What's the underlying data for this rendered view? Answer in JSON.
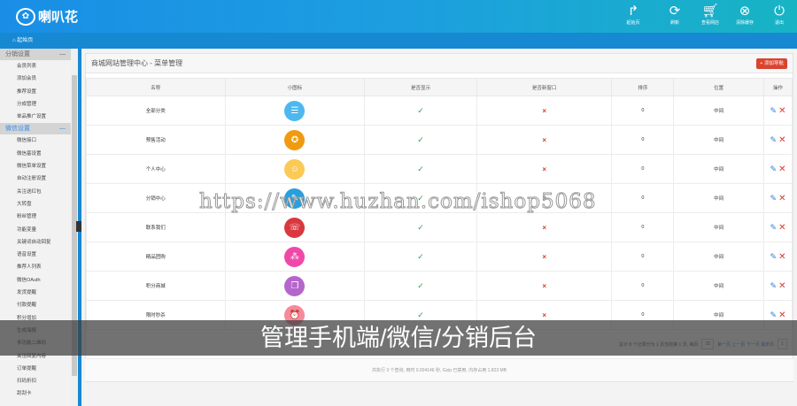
{
  "header": {
    "logo_text": "喇叭花",
    "buttons": [
      {
        "label": "起始页",
        "icon": "redo-arrow-icon"
      },
      {
        "label": "刷新",
        "icon": "refresh-icon"
      },
      {
        "label": "查看网店",
        "icon": "cart-icon"
      },
      {
        "label": "清除缓存",
        "icon": "clear-circle-icon"
      },
      {
        "label": "退出",
        "icon": "power-icon"
      }
    ]
  },
  "breadcrumb": {
    "home": "起始页"
  },
  "sidebar": {
    "groups": [
      {
        "label": "分销设置",
        "items": [
          "会员列表",
          "添加会员",
          "推荐设置",
          "分成管理",
          "单品推广设置"
        ]
      },
      {
        "label": "微信设置",
        "items": [
          "微信接口",
          "微信基设置",
          "微信菜单设置",
          "自动注册设置",
          "关注送红包",
          "大转盘",
          "粉丝管理",
          "功能变量",
          "关键词自动回复",
          "语音设置",
          "推荐人列表",
          "微信OAuth",
          "发货提醒",
          "付款提醒",
          "积分增加",
          "生成海报",
          "多功能二维码",
          "关注回复内容",
          "订单提醒",
          "扫码折扣",
          "刮刮卡"
        ]
      }
    ]
  },
  "panel": {
    "title": "商城网站管理中心 - 菜单管理",
    "add_button": "+ 添加导航"
  },
  "table": {
    "headers": [
      "名称",
      "小图标",
      "是否显示",
      "是否新窗口",
      "排序",
      "位置",
      "操作"
    ],
    "rows": [
      {
        "name": "全部分类",
        "icon": "category-icon",
        "color": "#4db8f0",
        "show": "✓",
        "new_window": "×",
        "sort": "0",
        "position": "中间"
      },
      {
        "name": "预售活动",
        "icon": "badge-icon",
        "color": "#ef9a10",
        "show": "✓",
        "new_window": "×",
        "sort": "0",
        "position": "中间"
      },
      {
        "name": "个人中心",
        "icon": "user-icon",
        "color": "#fbc955",
        "show": "✓",
        "new_window": "×",
        "sort": "0",
        "position": "中间"
      },
      {
        "name": "分销中心",
        "icon": "distribution-icon",
        "color": "#2a9fdc",
        "show": "✓",
        "new_window": "×",
        "sort": "0",
        "position": "中间"
      },
      {
        "name": "联系我们",
        "icon": "contact-icon",
        "color": "#d9383f",
        "show": "✓",
        "new_window": "×",
        "sort": "0",
        "position": "中间"
      },
      {
        "name": "精品团购",
        "icon": "group-icon",
        "color": "#f048a8",
        "show": "✓",
        "new_window": "×",
        "sort": "0",
        "position": "中间"
      },
      {
        "name": "积分商城",
        "icon": "gift-icon",
        "color": "#b466cc",
        "show": "✓",
        "new_window": "×",
        "sort": "0",
        "position": "中间"
      },
      {
        "name": "限时秒杀",
        "icon": "alarm-icon",
        "color": "#f58a9a",
        "show": "✓",
        "new_window": "×",
        "sort": "0",
        "position": "中间"
      }
    ]
  },
  "pager": {
    "summary": "总计 8 个记录分为 1 页当前第 1 页, 每页",
    "per_page": "15",
    "links": "第一页 上一页 下一页 最末页",
    "page_select": "1"
  },
  "footer": {
    "text": "共执行 3 个查询, 用时 0.004146 秒, Gzip 已禁用, 内存占用 1.823 MB"
  },
  "watermark": "https://www.huzhan.com/ishop5068",
  "banner": "管理手机端/微信/分销后台"
}
